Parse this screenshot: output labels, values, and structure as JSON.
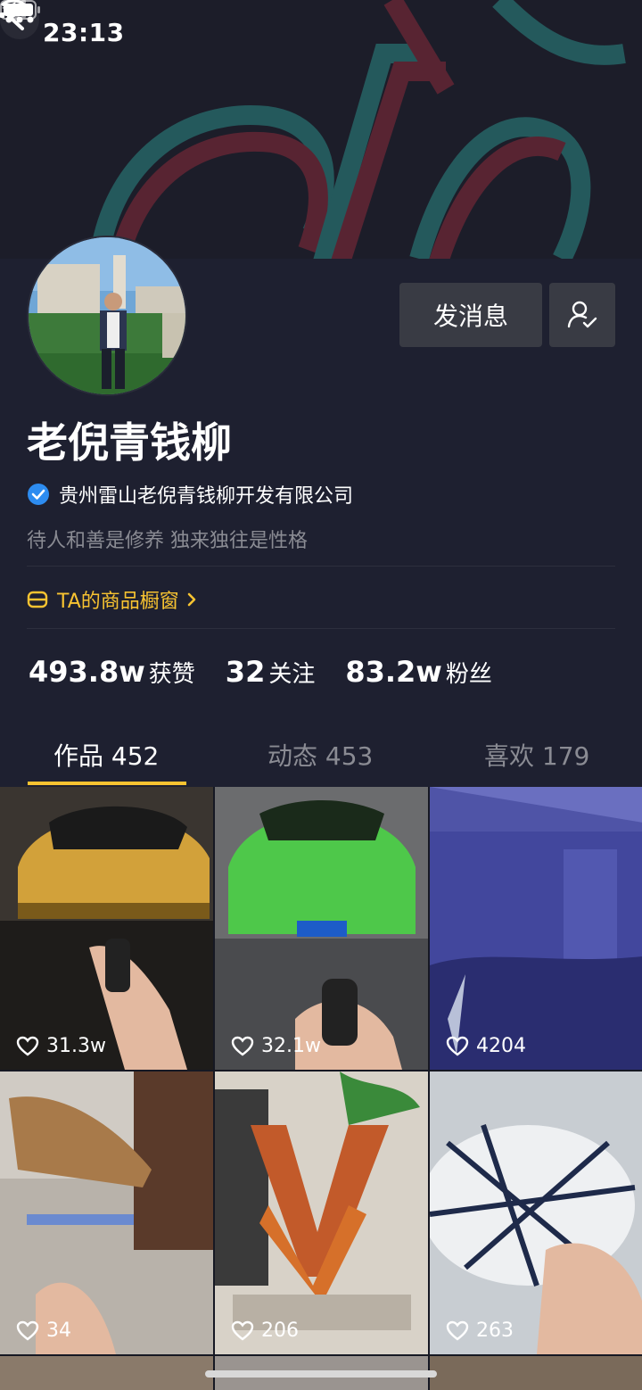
{
  "status_bar": {
    "time": "23:13"
  },
  "profile": {
    "nickname": "老倪青钱柳",
    "verification": "贵州雷山老倪青钱柳开发有限公司",
    "bio": "待人和善是修养 独来独往是性格",
    "shop_window": "TA的商品橱窗",
    "message_button": "发消息",
    "stats": [
      {
        "value": "493.8w",
        "label": "获赞"
      },
      {
        "value": "32",
        "label": "关注"
      },
      {
        "value": "83.2w",
        "label": "粉丝"
      }
    ]
  },
  "tabs": [
    {
      "label": "作品 452",
      "active": true
    },
    {
      "label": "动态 453",
      "active": false
    },
    {
      "label": "喜欢 179",
      "active": false
    }
  ],
  "videos": [
    {
      "likes": "31.3w",
      "color": "#d2a13a"
    },
    {
      "likes": "32.1w",
      "color": "#4ec84a"
    },
    {
      "likes": "4204",
      "color": "#4a4fa8"
    },
    {
      "likes": "34",
      "color": "#a87a4a"
    },
    {
      "likes": "206",
      "color": "#c25a2a"
    },
    {
      "likes": "263",
      "color": "#d6dce0"
    }
  ],
  "theme": {
    "accent": "#f8c331",
    "background": "#161823",
    "panel": "#1e2030",
    "verify_blue": "#2d8cf0"
  }
}
